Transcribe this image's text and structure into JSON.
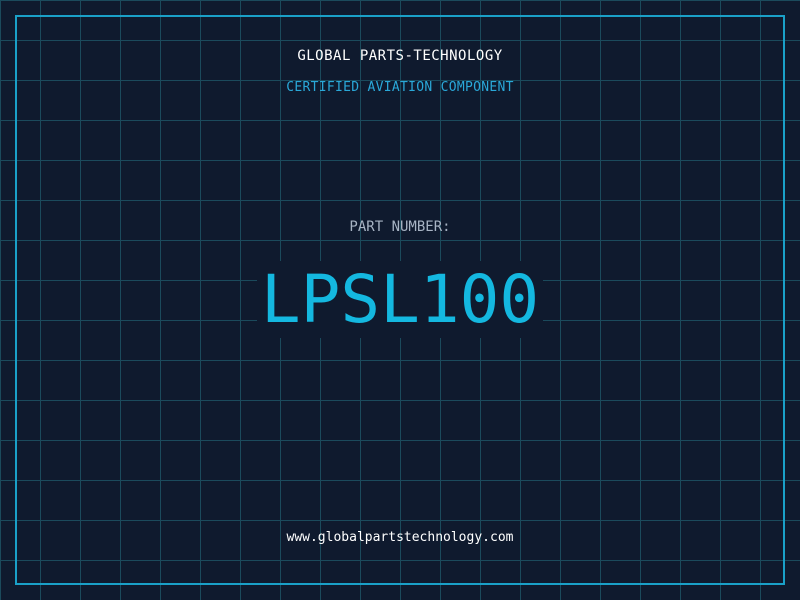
{
  "header": {
    "company": "GLOBAL PARTS-TECHNOLOGY",
    "subtitle": "CERTIFIED AVIATION COMPONENT"
  },
  "part": {
    "label": "PART NUMBER:",
    "number": "LPSL100"
  },
  "footer": {
    "website": "www.globalpartstechnology.com"
  },
  "colors": {
    "background": "#0f1a2e",
    "grid": "#1b4a5c",
    "frame": "#1aa0c8",
    "accent": "#14b8e0",
    "subtitle": "#2aa8d8",
    "label": "#a8b4c4",
    "text": "#ffffff"
  }
}
